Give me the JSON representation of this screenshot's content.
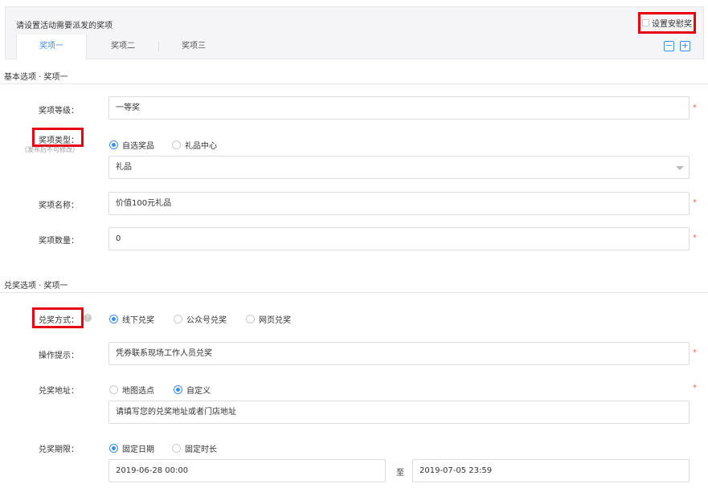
{
  "panel": {
    "title": "请设置活动需要派发的奖项",
    "consolation_label": "设置安慰奖",
    "tabs": [
      "奖项一",
      "奖项二",
      "奖项三"
    ],
    "remove_symbol": "−",
    "add_symbol": "+"
  },
  "basic": {
    "section_title": "基本选项 · 奖项一",
    "level_label": "奖项等级：",
    "level_value": "一等奖",
    "type_label": "奖项类型：",
    "type_note": "（发布后不可修改）",
    "type_options": [
      "自选奖品",
      "礼品中心"
    ],
    "type_selected": "自选奖品",
    "gift_select_value": "礼品",
    "name_label": "奖项名称：",
    "name_value": "价值100元礼品",
    "quantity_label": "奖项数量：",
    "quantity_value": "0"
  },
  "redeem": {
    "section_title": "兑奖选项 · 奖项一",
    "method_label": "兑奖方式：",
    "method_options": [
      "线下兑奖",
      "公众号兑奖",
      "网页兑奖"
    ],
    "method_selected": "线下兑奖",
    "hint_label": "操作提示：",
    "hint_value": "凭券联系现场工作人员兑奖",
    "address_label": "兑奖地址：",
    "address_options": [
      "地图选点",
      "自定义"
    ],
    "address_selected": "自定义",
    "address_value": "请填写您的兑奖地址或者门店地址",
    "period_label": "兑奖期限：",
    "period_options": [
      "固定日期",
      "固定时长"
    ],
    "period_selected": "固定日期",
    "start_date": "2019-06-28 00:00",
    "to_label": "至",
    "end_date": "2019-07-05 23:59"
  },
  "required_mark": "*",
  "colors": {
    "accent": "#3d8ee8",
    "highlight_box": "#e60012",
    "required": "#e86a5a"
  }
}
